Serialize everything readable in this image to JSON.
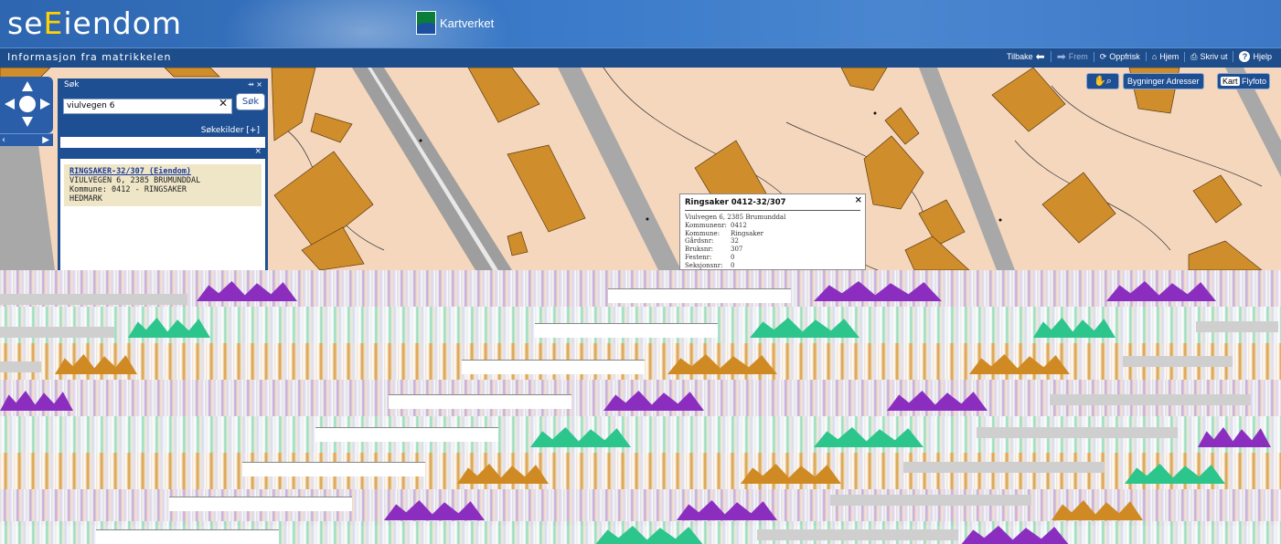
{
  "header": {
    "logo_prefix": "se",
    "logo_accent": "E",
    "logo_suffix": "iendom",
    "partner_label": "Kartverket"
  },
  "toolbar": {
    "subtitle": "Informasjon fra matrikkelen",
    "back_label": "Tilbake",
    "forward_label": "Frem",
    "refresh_label": "Oppfrisk",
    "home_label": "Hjem",
    "print_label": "Skriv ut",
    "help_label": "Hjelp"
  },
  "search": {
    "title": "Søk",
    "query": "viulvegen 6",
    "button_label": "Søk",
    "sources_label": "Søkekilder [+]",
    "result": {
      "link": "RINGSAKER-32/307 (Eiendom)",
      "line1": "VIULVEGEN 6, 2385 BRUMUNDDAL",
      "line2": "Kommune: 0412 - RINGSAKER",
      "line3": "HEDMARK"
    }
  },
  "map_controls": {
    "layers_label": "Bygninger Adresser",
    "base_map_label": "Kart",
    "aerial_label": "Flyfoto"
  },
  "popup": {
    "title": "Ringsaker 0412-32/307",
    "address": "Viulvegen 6, 2385 Brumunddal",
    "rows": [
      {
        "k": "Kommunenr:",
        "v": "0412"
      },
      {
        "k": "Kommune:",
        "v": "Ringsaker"
      },
      {
        "k": "Gårdsnr:",
        "v": "32"
      },
      {
        "k": "Bruksnr:",
        "v": "307"
      },
      {
        "k": "Festenr:",
        "v": "0"
      },
      {
        "k": "Seksjonsnr:",
        "v": "0"
      }
    ]
  },
  "colors": {
    "header_blue": "#2e66b0",
    "toolbar_blue": "#1e4d8c",
    "map_land": "#f4d7bd",
    "building": "#d08d2b",
    "road": "#a0a0a0",
    "logo_accent": "#ffd200"
  }
}
